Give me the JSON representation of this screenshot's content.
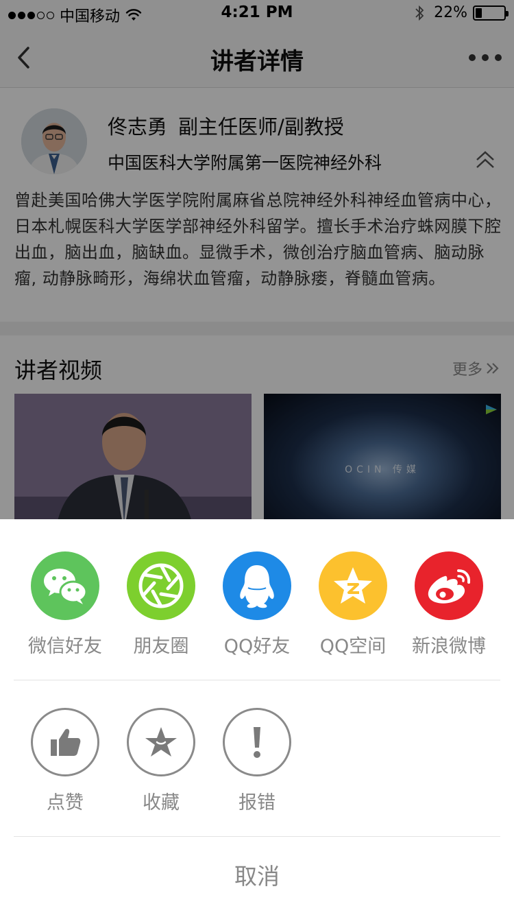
{
  "status_bar": {
    "carrier": "中国移动",
    "time": "4:21 PM",
    "battery_percent": "22%",
    "battery_level": 0.22,
    "signal_bars_filled": 3,
    "signal_bars_total": 5
  },
  "nav": {
    "title": "讲者详情",
    "back_icon": "chevron-left-icon",
    "more_icon": "ellipsis-icon"
  },
  "profile": {
    "name": "佟志勇",
    "title": "副主任医师/副教授",
    "hospital": "中国医科大学附属第一医院神经外科",
    "bio": "曾赴美国哈佛大学医学院附属麻省总院神经外科神经血管病中心，日本札幌医科大学医学部神经外科留学。擅长手术治疗蛛网膜下腔出血，脑出血，脑缺血。显微手术，微创治疗脑血管病、脑动脉瘤, 动静脉畸形，海绵状血管瘤，动静脉瘘，脊髓血管病。"
  },
  "videos": {
    "section_title": "讲者视频",
    "more_label": "更多",
    "items": [
      {
        "caption": ""
      },
      {
        "caption": "OCIN 传媒"
      }
    ]
  },
  "share_sheet": {
    "share_targets": [
      {
        "label": "微信好友",
        "icon": "wechat-icon",
        "color": "#5ec45c"
      },
      {
        "label": "朋友圈",
        "icon": "moments-icon",
        "color": "#7dcf2e"
      },
      {
        "label": "QQ好友",
        "icon": "qq-icon",
        "color": "#1e8ae6"
      },
      {
        "label": "QQ空间",
        "icon": "qzone-icon",
        "color": "#fcc12e"
      },
      {
        "label": "新浪微博",
        "icon": "weibo-icon",
        "color": "#e8232c"
      }
    ],
    "actions": [
      {
        "label": "点赞",
        "icon": "thumbs-up-icon"
      },
      {
        "label": "收藏",
        "icon": "star-icon"
      },
      {
        "label": "报错",
        "icon": "exclamation-icon"
      }
    ],
    "cancel_label": "取消"
  }
}
